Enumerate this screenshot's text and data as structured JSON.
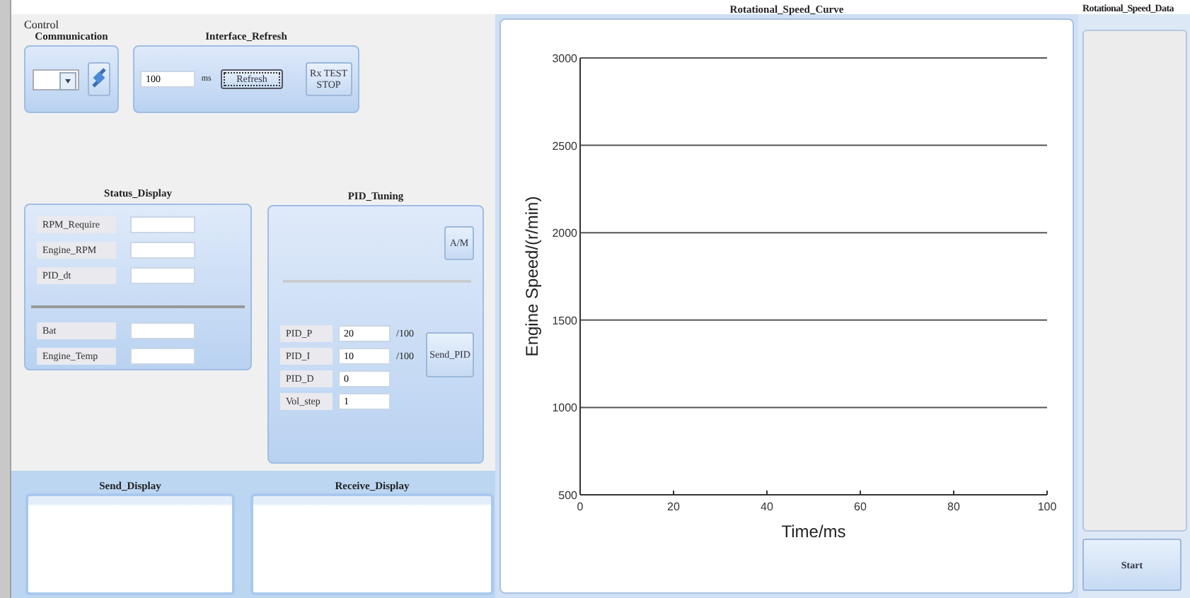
{
  "control_group": {
    "title": "Control"
  },
  "communication": {
    "title": "Communication"
  },
  "interface_refresh": {
    "title": "Interface_Refresh",
    "interval": "100",
    "unit": "ms",
    "buttons": [
      {
        "label": "Refresh",
        "focused": true
      },
      {
        "label": "Rx TEST STOP",
        "focused": false
      }
    ]
  },
  "status_display": {
    "title": "Status_Display",
    "groups": [
      {
        "fields": [
          {
            "label": "RPM_Require"
          },
          {
            "label": "Engine_RPM"
          },
          {
            "label": "PID_dt"
          }
        ]
      },
      {
        "fields": [
          {
            "label": "Bat"
          },
          {
            "label": "Engine_Temp"
          }
        ]
      }
    ]
  },
  "pid_tuning": {
    "title": "PID_Tuning",
    "mode_button": "A/M",
    "send_button": "Send_PID",
    "params": [
      {
        "label": "PID_P",
        "value": "20",
        "unit": "/100"
      },
      {
        "label": "PID_I",
        "value": "10",
        "unit": "/100"
      },
      {
        "label": "PID_D",
        "value": "0"
      },
      {
        "label": "Vol_step",
        "value": "1"
      }
    ]
  },
  "send_display": {
    "title": "Send_Display"
  },
  "receive_display": {
    "title": "Receive_Display"
  },
  "speed_curve": {
    "title": "Rotational_Speed_Curve",
    "chart_data": {
      "type": "line",
      "grid": true,
      "xlabel": "Time/ms",
      "ylabel": "Engine Speed/(r/min)",
      "xlim": [
        0,
        100
      ],
      "ylim": [
        500,
        3000
      ],
      "xticks": [
        0,
        20,
        40,
        60,
        80,
        100
      ],
      "yticks": [
        500,
        1000,
        1500,
        2000,
        2500,
        3000
      ]
    }
  },
  "speed_data": {
    "title": "Rotational_Speed_Data",
    "start_button": "Start"
  }
}
